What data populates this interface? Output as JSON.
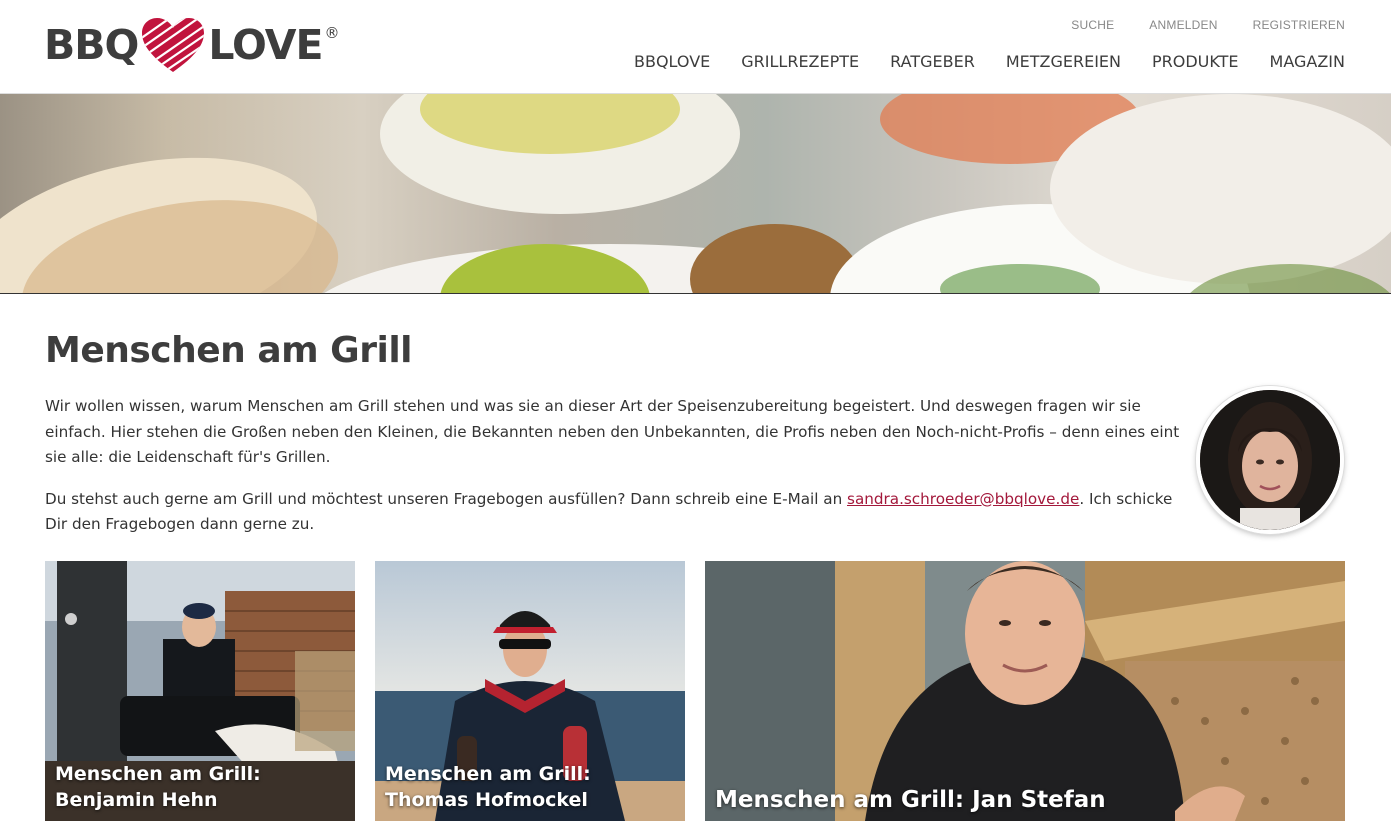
{
  "header": {
    "logo_left": "BBQ",
    "logo_right": "LOVE",
    "logo_reg": "®",
    "top_links": [
      "SUCHE",
      "ANMELDEN",
      "REGISTRIEREN"
    ],
    "main_links": [
      "BBQLOVE",
      "GRILLREZEPTE",
      "RATGEBER",
      "METZGEREIEN",
      "PRODUKTE",
      "MAGAZIN"
    ]
  },
  "page": {
    "title": "Menschen am Grill",
    "intro_p1": "Wir wollen wissen, warum Menschen am Grill stehen und was sie an dieser Art der Speisenzubereitung begeistert. Und deswegen fragen wir sie einfach. Hier stehen die Großen neben den Kleinen, die Bekannten neben den Unbekannten, die Profis neben den Noch-nicht-Profis – denn eines eint sie alle: die Leidenschaft für's Grillen.",
    "intro_p2_before": "Du stehst auch gerne am Grill und möchtest unseren Fragebogen ausfüllen? Dann schreib eine E-Mail an ",
    "intro_p2_email": "sandra.schroeder@bbqlove.de",
    "intro_p2_after": ". Ich schicke Dir den Fragebogen dann gerne zu."
  },
  "cards": [
    {
      "title": "Menschen am Grill: Benjamin Hehn"
    },
    {
      "title": "Menschen am Grill: Thomas Hofmockel"
    },
    {
      "title": "Menschen am Grill: Jan Stefan"
    }
  ],
  "colors": {
    "brand_red": "#c1143d",
    "link_red": "#a3183b",
    "text_dark": "#3d3d3d"
  }
}
